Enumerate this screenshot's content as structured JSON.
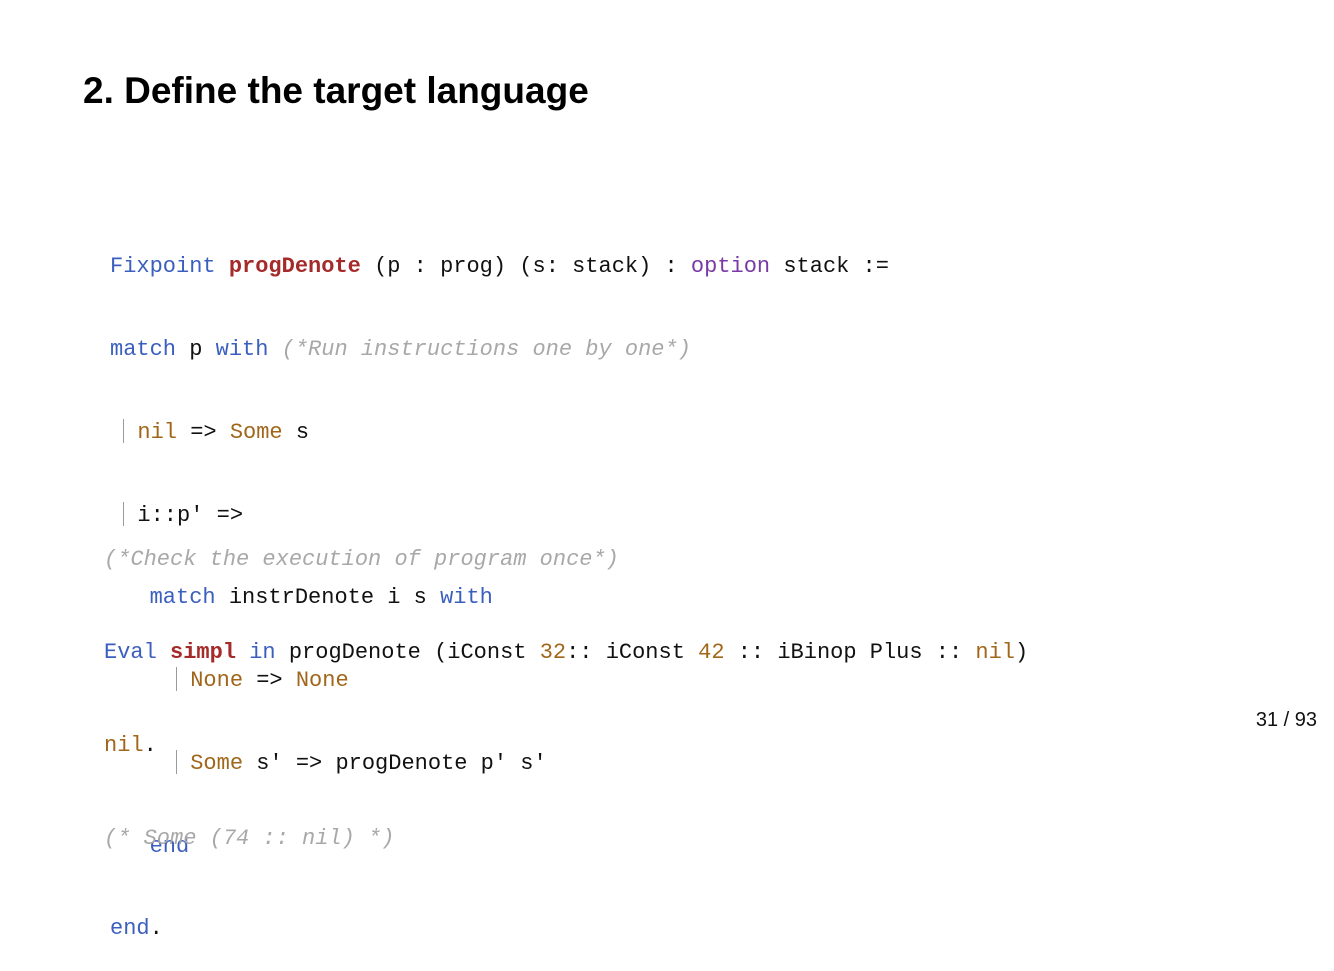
{
  "slide": {
    "title": "2. Define the target language",
    "page_number": "31 / 93"
  },
  "code1": {
    "l1": {
      "kw_fixpoint": "Fixpoint",
      "fn_name": "progDenote",
      "sig_a": "(p : prog) (s: stack) :",
      "ty_option": "option",
      "sig_b": "stack :="
    },
    "l2": {
      "kw_match": "match",
      "var_p": "p",
      "kw_with": "with",
      "comment": "(*Run instructions one by one*)"
    },
    "l3": {
      "ctor_nil": "nil",
      "arrow": "=>",
      "ctor_some": "Some",
      "var_s": "s"
    },
    "l4": {
      "pattern": "i::p' =>"
    },
    "l5": {
      "kw_match": "match",
      "expr": "instrDenote i s",
      "kw_with": "with"
    },
    "l6": {
      "ctor_none_a": "None",
      "arrow": "=>",
      "ctor_none_b": "None"
    },
    "l7": {
      "ctor_some": "Some",
      "rest": "s' => progDenote p' s'"
    },
    "l8": {
      "kw_end": "end"
    },
    "l9": {
      "kw_end": "end",
      "dot": "."
    }
  },
  "code2": {
    "comment1": "(*Check the execution of program once*)",
    "eval": {
      "kw_eval": "Eval",
      "fn_simpl": "simpl",
      "kw_in": "in",
      "call_a": "progDenote (iConst",
      "num_32": "32",
      "sep_a": ":: iConst",
      "num_42": "42",
      "sep_b": ":: iBinop Plus ::",
      "ctor_nil": "nil",
      "close": ")"
    },
    "l_nil": {
      "ctor_nil": "nil",
      "dot": "."
    },
    "comment2": "(* Some (74 :: nil) *)"
  }
}
